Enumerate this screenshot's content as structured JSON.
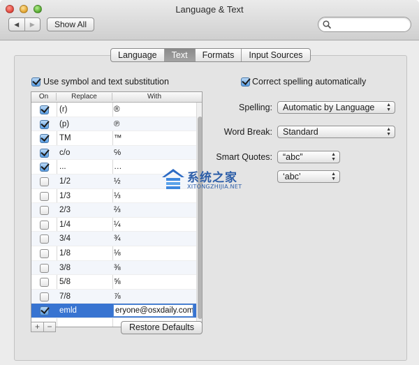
{
  "window": {
    "title": "Language & Text"
  },
  "toolbar": {
    "back_icon": "chevron-left-icon",
    "forward_icon": "chevron-right-icon",
    "show_all_label": "Show All",
    "search_placeholder": ""
  },
  "tabs": [
    {
      "label": "Language",
      "selected": false
    },
    {
      "label": "Text",
      "selected": true
    },
    {
      "label": "Formats",
      "selected": false
    },
    {
      "label": "Input Sources",
      "selected": false
    }
  ],
  "substitution": {
    "checkbox_label": "Use symbol and text substitution",
    "checked": true,
    "columns": {
      "on": "On",
      "replace": "Replace",
      "with": "With"
    },
    "rows": [
      {
        "on": true,
        "replace": "(r)",
        "with": "®"
      },
      {
        "on": true,
        "replace": "(p)",
        "with": "℗"
      },
      {
        "on": true,
        "replace": "TM",
        "with": "™"
      },
      {
        "on": true,
        "replace": "c/o",
        "with": "℅"
      },
      {
        "on": true,
        "replace": "...",
        "with": "…"
      },
      {
        "on": false,
        "replace": "1/2",
        "with": "½"
      },
      {
        "on": false,
        "replace": "1/3",
        "with": "⅓"
      },
      {
        "on": false,
        "replace": "2/3",
        "with": "⅔"
      },
      {
        "on": false,
        "replace": "1/4",
        "with": "¼"
      },
      {
        "on": false,
        "replace": "3/4",
        "with": "¾"
      },
      {
        "on": false,
        "replace": "1/8",
        "with": "⅛"
      },
      {
        "on": false,
        "replace": "3/8",
        "with": "⅜"
      },
      {
        "on": false,
        "replace": "5/8",
        "with": "⅝"
      },
      {
        "on": false,
        "replace": "7/8",
        "with": "⅞"
      },
      {
        "on": true,
        "replace": "emld",
        "with": "eryone@osxdaily.com",
        "selected": true
      }
    ],
    "add_label": "+",
    "remove_label": "−",
    "restore_label": "Restore Defaults"
  },
  "spelling_section": {
    "correct_label": "Correct spelling automatically",
    "correct_checked": true,
    "spelling_label": "Spelling:",
    "spelling_value": "Automatic by Language",
    "word_break_label": "Word Break:",
    "word_break_value": "Standard",
    "smart_quotes_label": "Smart Quotes:",
    "double_quotes_value": "“abc”",
    "single_quotes_value": "‘abc’"
  },
  "watermark": {
    "title": "系统之家",
    "subtitle": "XITONGZHIJIA.NET"
  },
  "colors": {
    "selection": "#3874d1",
    "checkbox_on": "#5a9ee3"
  }
}
